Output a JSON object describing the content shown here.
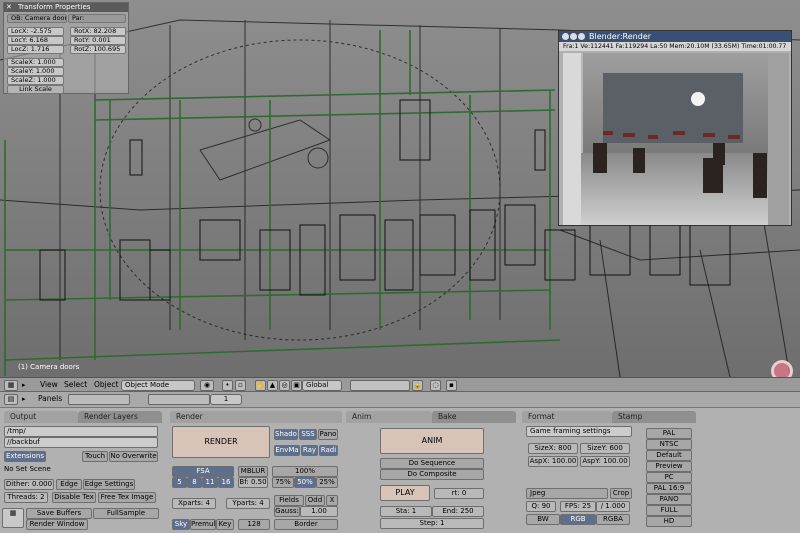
{
  "viewport": {
    "object_label": "(1) Camera doors"
  },
  "transform": {
    "title": "Transform Properties",
    "ob": "OB: Camera doors",
    "par": "Par:",
    "locx": "LocX: -2.575",
    "locy": "LocY: 6.168",
    "locz": "LocZ: 1.716",
    "rotx": "RotX: 82.208",
    "roty": "RotY: 0.001",
    "rotz": "RotZ: 100.695",
    "scalex": "ScaleX: 1.000",
    "scaley": "ScaleY: 1.000",
    "scalez": "ScaleZ: 1.000",
    "link_scale": "Link Scale"
  },
  "render_window": {
    "title": "Blender:Render",
    "info": "Fra:1  Ve:112441 Fa:119294 La:50 Mem:20.10M (33.65M) Time:01:00.77"
  },
  "view_header": {
    "view": "View",
    "select": "Select",
    "object": "Object",
    "mode": "Object Mode",
    "orientation": "Global"
  },
  "panels_header": {
    "panels": "Panels",
    "frame": "1"
  },
  "output": {
    "tab": "Output",
    "tab2": "Render Layers",
    "path1": "/tmp/",
    "path2": "//backbuf",
    "extensions": "Extensions",
    "touch": "Touch",
    "no_overwrite": "No Overwrite",
    "scene": "No Set Scene",
    "dither": "Dither: 0.000",
    "edge": "Edge",
    "edge_settings": "Edge Settings",
    "threads": "Threads: 2",
    "disable_tex": "Disable Tex",
    "free_tex": "Free Tex Image",
    "save_buffers": "Save Buffers",
    "fullsample": "FullSample",
    "render_window": "Render Window"
  },
  "render": {
    "tab": "Render",
    "render_btn": "RENDER",
    "shado": "Shado",
    "sss": "SSS",
    "pano": "Pano",
    "envma": "EnvMa",
    "ray": "Ray",
    "radi": "Radi",
    "fsa": "FSA",
    "osa": [
      "5",
      "8",
      "11",
      "16"
    ],
    "mblur": "MBLUR",
    "bf": "Bf: 0.50",
    "pct100": "100%",
    "pct75": "75%",
    "pct50": "50%",
    "pct25": "25%",
    "xparts": "Xparts: 4",
    "yparts": "Yparts: 4",
    "fields": "Fields",
    "odd": "Odd",
    "x": "X",
    "gauss": "Gauss:",
    "gauss_val": "1.00",
    "sky": "Sky",
    "premul": "Premul",
    "key": "Key",
    "bits": "128",
    "border": "Border"
  },
  "anim": {
    "tab": "Anim",
    "tab2": "Bake",
    "anim_btn": "ANIM",
    "do_sequence": "Do Sequence",
    "do_composite": "Do Composite",
    "play": "PLAY",
    "rt": "rt: 0",
    "sta": "Sta: 1",
    "end": "End: 250",
    "step": "Step: 1"
  },
  "format": {
    "tab": "Format",
    "tab2": "Stamp",
    "preset": "Game framing settings",
    "sizex": "SizeX: 800",
    "sizey": "SizeY: 600",
    "aspx": "AspX: 100.00",
    "aspy": "AspY: 100.00",
    "filetype": "Jpeg",
    "crop": "Crop",
    "quality": "Q: 90",
    "fps": "FPS: 25",
    "fps_base": "/ 1.000",
    "bw": "BW",
    "rgb": "RGB",
    "rgba": "RGBA",
    "presets": [
      "PAL",
      "NTSC",
      "Default",
      "Preview",
      "PC",
      "PAL 16:9",
      "PANO",
      "FULL",
      "HD"
    ]
  },
  "colors": {
    "selected_button": "#5d6f8c",
    "wire_green": "#2f6b2f",
    "render_title": "#3a4f74"
  }
}
